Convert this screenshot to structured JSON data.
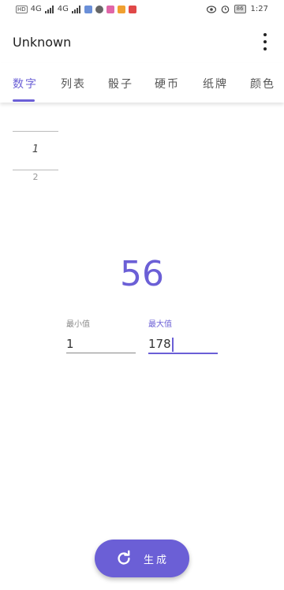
{
  "status_bar": {
    "network1": "4G",
    "network2": "4G",
    "battery": "86",
    "time": "1:27"
  },
  "app_bar": {
    "title": "Unknown"
  },
  "tabs": [
    {
      "label": "数字",
      "active": true
    },
    {
      "label": "列表",
      "active": false
    },
    {
      "label": "骰子",
      "active": false
    },
    {
      "label": "硬币",
      "active": false
    },
    {
      "label": "纸牌",
      "active": false
    },
    {
      "label": "颜色",
      "active": false
    }
  ],
  "picker": {
    "selected": "1",
    "next": "2"
  },
  "result": "56",
  "min_field": {
    "label": "最小值",
    "value": "1"
  },
  "max_field": {
    "label": "最大值",
    "value": "178"
  },
  "generate_button": {
    "label": "生成"
  },
  "colors": {
    "accent": "#6b5fd6"
  }
}
